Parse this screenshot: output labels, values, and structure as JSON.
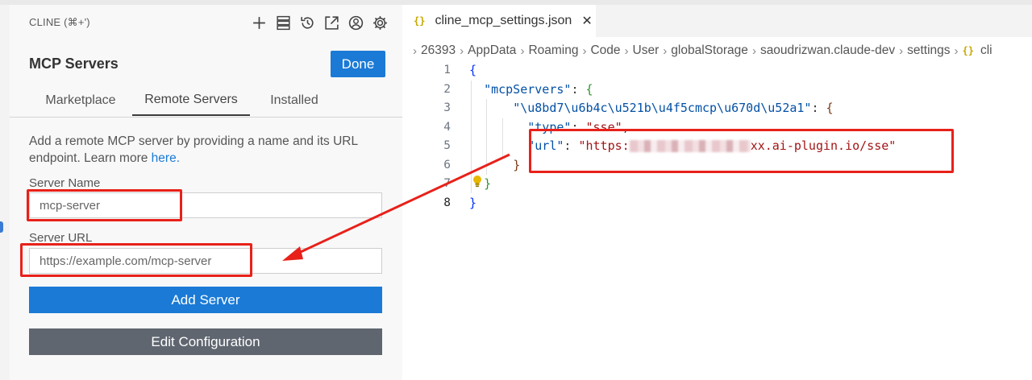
{
  "panel": {
    "title": "CLINE (⌘+')",
    "header_icons": [
      "plus-icon",
      "server-list-icon",
      "history-icon",
      "popout-icon",
      "account-icon",
      "settings-gear-icon"
    ],
    "heading": "MCP Servers",
    "done_label": "Done",
    "tabs": [
      {
        "label": "Marketplace",
        "active": false
      },
      {
        "label": "Remote Servers",
        "active": true
      },
      {
        "label": "Installed",
        "active": false
      }
    ],
    "description": "Add a remote MCP server by providing a name and its URL endpoint. Learn more",
    "description_link": "here.",
    "server_name": {
      "label": "Server Name",
      "placeholder": "mcp-server"
    },
    "server_url": {
      "label": "Server URL",
      "placeholder": "https://example.com/mcp-server"
    },
    "add_server_label": "Add Server",
    "edit_config_label": "Edit Configuration"
  },
  "editor": {
    "tab": {
      "icon": "{}",
      "label": "cline_mcp_settings.json",
      "close": "✕"
    },
    "breadcrumb": [
      "26393",
      "AppData",
      "Roaming",
      "Code",
      "User",
      "globalStorage",
      "saoudrizwan.claude-dev",
      "settings",
      "cli"
    ],
    "breadcrumb_json_icon": "{}",
    "line_numbers": [
      "1",
      "2",
      "3",
      "4",
      "5",
      "6",
      "7",
      "8"
    ],
    "code": {
      "l2_key": "\"mcpServers\"",
      "l3_key": "\"\\u8bd7\\u6b4c\\u521b\\u4f5cmcp\\u670d\\u52a1\"",
      "l4_key": "\"type\"",
      "l4_val": "\"sse\"",
      "l5_key": "\"url\"",
      "l5_val_start": "\"https:",
      "l5_val_end": "xx.ai-plugin.io/sse\""
    }
  },
  "colors": {
    "accent": "#1a7ad6",
    "secondary_button": "#5f6670",
    "annotation": "#e8211a"
  }
}
